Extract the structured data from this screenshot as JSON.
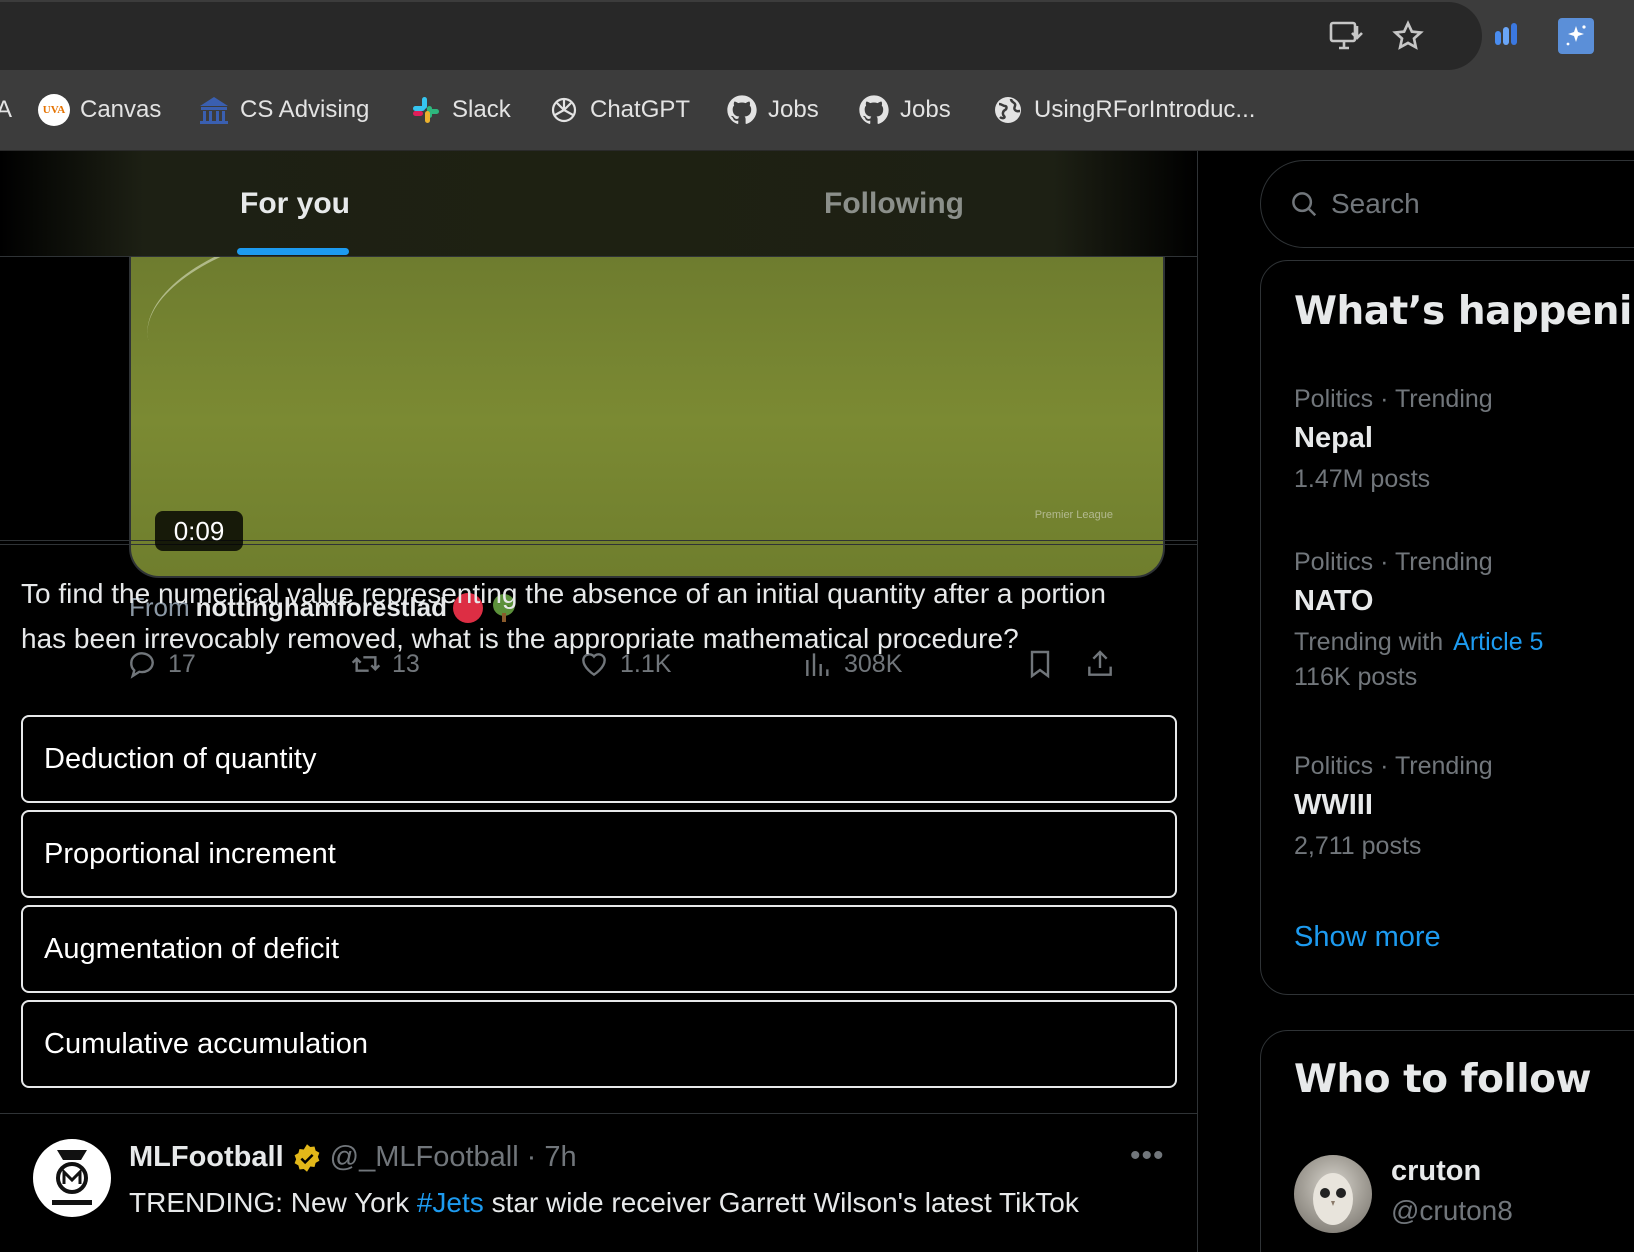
{
  "browser": {
    "bookmarks": [
      {
        "label": "A",
        "icon": "bookmark-partial"
      },
      {
        "label": "Canvas",
        "icon": "uva-icon"
      },
      {
        "label": "CS Advising",
        "icon": "building-icon"
      },
      {
        "label": "Slack",
        "icon": "slack-icon"
      },
      {
        "label": "ChatGPT",
        "icon": "openai-icon"
      },
      {
        "label": "Jobs",
        "icon": "github-icon"
      },
      {
        "label": "Jobs",
        "icon": "github-icon"
      },
      {
        "label": "UsingRForIntroduc...",
        "icon": "globe-icon"
      }
    ],
    "uva_badge": "UVA"
  },
  "tabs": {
    "for_you": "For you",
    "following": "Following"
  },
  "video_tweet": {
    "duration": "0:09",
    "watermark": "Premier League",
    "from_label": "From",
    "from_handle": "nottinghamforestlad",
    "actions": {
      "replies": "17",
      "reposts": "13",
      "likes": "1.1K",
      "views": "308K"
    }
  },
  "quiz": {
    "question": "To find the numerical value representing the absence of an initial quantity after a portion has been irrevocably removed, what is the appropriate mathematical procedure?",
    "options": [
      "Deduction of quantity",
      "Proportional increment",
      "Augmentation of deficit",
      "Cumulative accumulation"
    ]
  },
  "next_tweet": {
    "name": "MLFootball",
    "handle": "@_MLFootball",
    "time": "· 7h",
    "text_before": "TRENDING: New York ",
    "hashtag": "#Jets",
    "text_after": " star wide receiver Garrett Wilson's latest TikTok"
  },
  "sidebar": {
    "search_placeholder": "Search",
    "whats_happening": {
      "title": "What’s happening",
      "trends": [
        {
          "category": "Politics · Trending",
          "name": "Nepal",
          "posts": "1.47M posts"
        },
        {
          "category": "Politics · Trending",
          "name": "NATO",
          "with_label": "Trending with",
          "with_link": "Article 5",
          "posts": "116K posts"
        },
        {
          "category": "Politics · Trending",
          "name": "WWIII",
          "posts": "2,711 posts"
        }
      ],
      "show_more": "Show more"
    },
    "who_to_follow": {
      "title": "Who to follow",
      "users": [
        {
          "name": "cruton",
          "handle": "@cruton8"
        }
      ]
    }
  },
  "colors": {
    "accent": "#1d9bf0",
    "background": "#000000",
    "border": "#2f3336",
    "muted": "#71767b"
  }
}
